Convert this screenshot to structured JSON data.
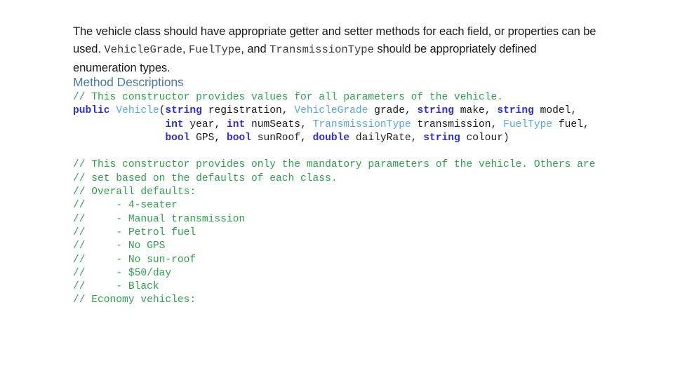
{
  "slide": {
    "intro": {
      "segments": [
        {
          "kind": "text",
          "text": "The vehicle class should have appropriate getter and setter methods for each field, or properties can be used. "
        },
        {
          "kind": "code",
          "text": "VehicleGrade"
        },
        {
          "kind": "text",
          "text": ", "
        },
        {
          "kind": "code",
          "text": "FuelType"
        },
        {
          "kind": "text",
          "text": ", and "
        },
        {
          "kind": "code",
          "text": "TransmissionType"
        },
        {
          "kind": "text",
          "text": " should be appropriately defined enumeration types."
        }
      ]
    },
    "section_heading": "Method Descriptions",
    "colors": {
      "heading": "#4a7ba6",
      "comment": "#2da14c",
      "keyword": "#2f2fd4",
      "type": "#54a8de",
      "plain": "#1a1a1a",
      "background": "#ffffff"
    },
    "code_lines": [
      {
        "id": "comment-ctor-all",
        "tokens": [
          {
            "class": "tok-comment",
            "text": "// This constructor provides values for all parameters of the vehicle."
          }
        ]
      },
      {
        "id": "ctor-signature-line-1",
        "tokens": [
          {
            "class": "tok-keyword",
            "text": "public"
          },
          {
            "class": "tok-plain",
            "text": " "
          },
          {
            "class": "tok-type",
            "text": "Vehicle"
          },
          {
            "class": "tok-plain",
            "text": "("
          },
          {
            "class": "tok-keyword",
            "text": "string"
          },
          {
            "class": "tok-plain",
            "text": " registration, "
          },
          {
            "class": "tok-type",
            "text": "VehicleGrade"
          },
          {
            "class": "tok-plain",
            "text": " grade, "
          },
          {
            "class": "tok-keyword",
            "text": "string"
          },
          {
            "class": "tok-plain",
            "text": " make, "
          },
          {
            "class": "tok-keyword",
            "text": "string"
          },
          {
            "class": "tok-plain",
            "text": " model,"
          }
        ]
      },
      {
        "id": "ctor-signature-line-2",
        "tokens": [
          {
            "class": "tok-plain",
            "text": "               "
          },
          {
            "class": "tok-keyword",
            "text": "int"
          },
          {
            "class": "tok-plain",
            "text": " year, "
          },
          {
            "class": "tok-keyword",
            "text": "int"
          },
          {
            "class": "tok-plain",
            "text": " numSeats, "
          },
          {
            "class": "tok-type",
            "text": "TransmissionType"
          },
          {
            "class": "tok-plain",
            "text": " transmission, "
          },
          {
            "class": "tok-type",
            "text": "FuelType"
          },
          {
            "class": "tok-plain",
            "text": " fuel,"
          }
        ]
      },
      {
        "id": "ctor-signature-line-3",
        "tokens": [
          {
            "class": "tok-plain",
            "text": "               "
          },
          {
            "class": "tok-keyword",
            "text": "bool"
          },
          {
            "class": "tok-plain",
            "text": " GPS, "
          },
          {
            "class": "tok-keyword",
            "text": "bool"
          },
          {
            "class": "tok-plain",
            "text": " sunRoof, "
          },
          {
            "class": "tok-keyword",
            "text": "double"
          },
          {
            "class": "tok-plain",
            "text": " dailyRate, "
          },
          {
            "class": "tok-keyword",
            "text": "string"
          },
          {
            "class": "tok-plain",
            "text": " colour)"
          }
        ]
      },
      {
        "id": "blank-1",
        "tokens": []
      },
      {
        "id": "comment-ctor-mandatory-1",
        "tokens": [
          {
            "class": "tok-comment",
            "text": "// This constructor provides only the mandatory parameters of the vehicle. Others are"
          }
        ]
      },
      {
        "id": "comment-ctor-mandatory-2",
        "tokens": [
          {
            "class": "tok-comment",
            "text": "// set based on the defaults of each class."
          }
        ]
      },
      {
        "id": "comment-overall-defaults",
        "tokens": [
          {
            "class": "tok-comment",
            "text": "// Overall defaults:"
          }
        ]
      },
      {
        "id": "comment-default-seater",
        "tokens": [
          {
            "class": "tok-comment",
            "text": "//     - 4-seater"
          }
        ]
      },
      {
        "id": "comment-default-transmission",
        "tokens": [
          {
            "class": "tok-comment",
            "text": "//     - Manual transmission"
          }
        ]
      },
      {
        "id": "comment-default-fuel",
        "tokens": [
          {
            "class": "tok-comment",
            "text": "//     - Petrol fuel"
          }
        ]
      },
      {
        "id": "comment-default-gps",
        "tokens": [
          {
            "class": "tok-comment",
            "text": "//     - No GPS"
          }
        ]
      },
      {
        "id": "comment-default-sunroof",
        "tokens": [
          {
            "class": "tok-comment",
            "text": "//     - No sun-roof"
          }
        ]
      },
      {
        "id": "comment-default-rate",
        "tokens": [
          {
            "class": "tok-comment",
            "text": "//     - $50/day"
          }
        ]
      },
      {
        "id": "comment-default-colour",
        "tokens": [
          {
            "class": "tok-comment",
            "text": "//     - Black"
          }
        ]
      },
      {
        "id": "comment-economy-vehicles",
        "tokens": [
          {
            "class": "tok-comment",
            "text": "// Economy vehicles:"
          }
        ]
      }
    ]
  }
}
